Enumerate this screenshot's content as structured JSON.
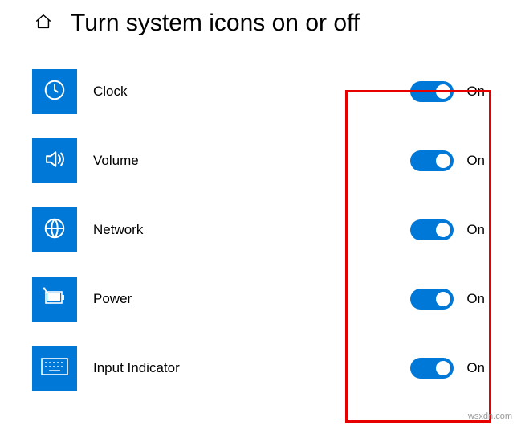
{
  "header": {
    "title": "Turn system icons on or off"
  },
  "items": [
    {
      "icon": "clock-icon",
      "label": "Clock",
      "state": "On"
    },
    {
      "icon": "volume-icon",
      "label": "Volume",
      "state": "On"
    },
    {
      "icon": "network-icon",
      "label": "Network",
      "state": "On"
    },
    {
      "icon": "power-icon",
      "label": "Power",
      "state": "On"
    },
    {
      "icon": "keyboard-icon",
      "label": "Input Indicator",
      "state": "On"
    }
  ],
  "watermark": "wsxdn.com"
}
